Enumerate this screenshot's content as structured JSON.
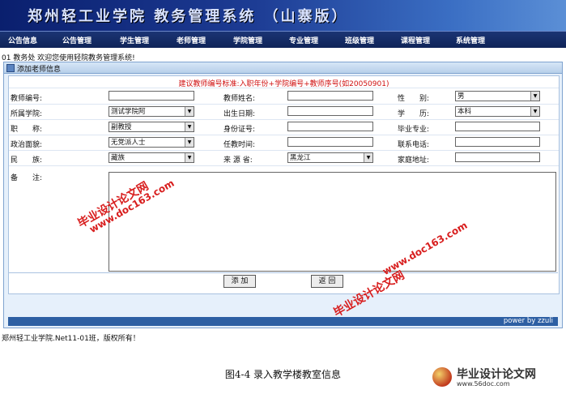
{
  "header": {
    "title": "郑州轻工业学院 教务管理系统 （山寨版）"
  },
  "nav": [
    "公告信息",
    "公告管理",
    "学生管理",
    "老师管理",
    "学院管理",
    "专业管理",
    "班级管理",
    "课程管理",
    "系统管理"
  ],
  "welcome": "01 教务处 欢迎您使用轻院教务管理系统!",
  "panel": {
    "title": "添加老师信息"
  },
  "hint": "建议教师编号标准:入职年份+学院编号+教师序号(如20050901)",
  "form": {
    "teacher_no": {
      "label": "教师编号:",
      "value": ""
    },
    "teacher_name": {
      "label": "教师姓名:",
      "value": ""
    },
    "gender": {
      "label": "性　　别:",
      "value": "男"
    },
    "college": {
      "label": "所属学院:",
      "value": "测试学院阿"
    },
    "birth": {
      "label": "出生日期:",
      "value": ""
    },
    "education": {
      "label": "学　　历:",
      "value": "本科"
    },
    "title": {
      "label": "职　　称:",
      "value": "副教授"
    },
    "id_no": {
      "label": "身份证号:",
      "value": ""
    },
    "major": {
      "label": "毕业专业:",
      "value": ""
    },
    "politics": {
      "label": "政治面貌:",
      "value": "无党派人士"
    },
    "hire_time": {
      "label": "任教时间:",
      "value": ""
    },
    "phone": {
      "label": "联系电话:",
      "value": ""
    },
    "nation": {
      "label": "民　　族:",
      "value": "藏族"
    },
    "origin": {
      "label": "来 源 省:",
      "value": "黑龙江"
    },
    "address": {
      "label": "家庭地址:",
      "value": ""
    },
    "notes": {
      "label": "备　　注:",
      "value": ""
    }
  },
  "buttons": {
    "add": "添 加",
    "back": "返 回"
  },
  "footer": {
    "power": "power  by  zzuli"
  },
  "copyright": "郑州轻工业学院.Net11-01班，版权所有！",
  "caption": "图4-4  录入教学楼教室信息",
  "watermark": {
    "text1": "毕业设计论文网",
    "text2": "www.doc163.com"
  },
  "logo": {
    "name": "毕业设计论文网",
    "url": "www.56doc.com"
  }
}
